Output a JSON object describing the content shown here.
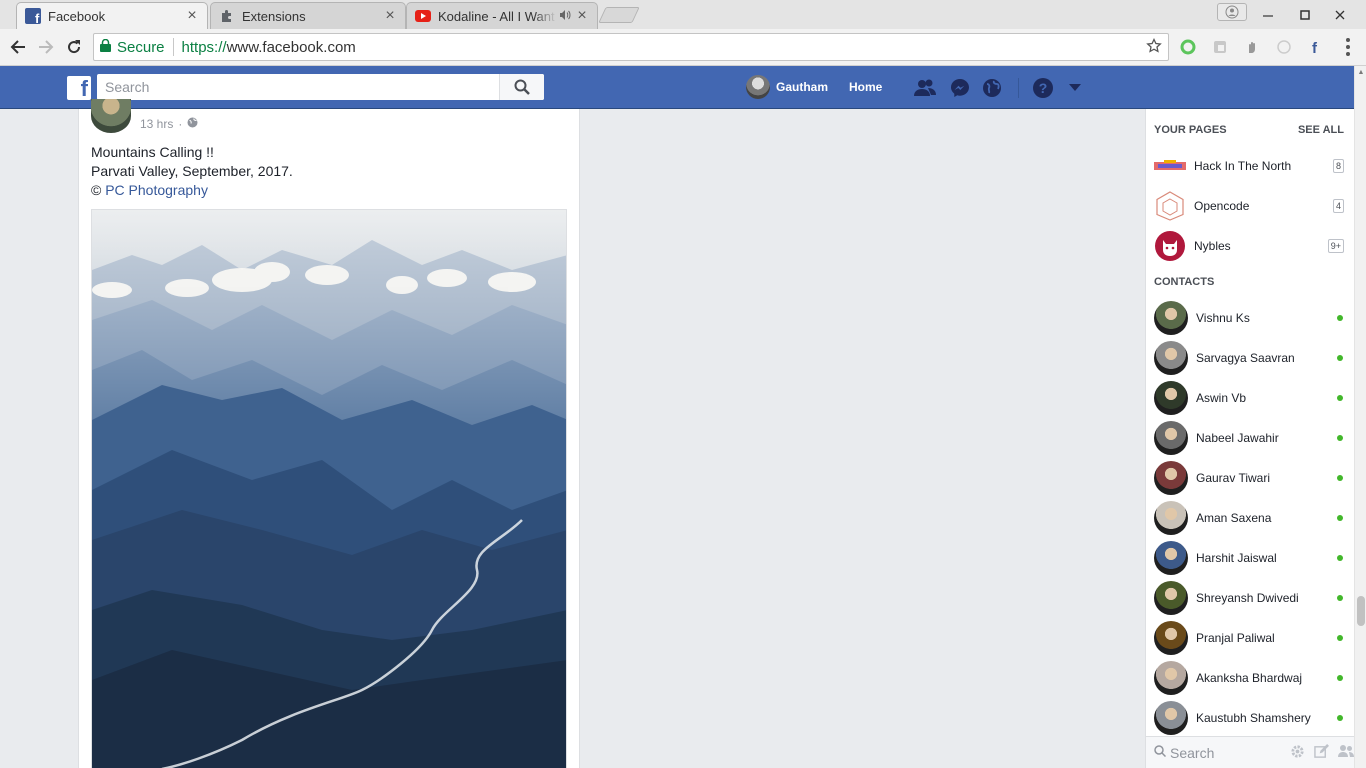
{
  "browser": {
    "tabs": [
      {
        "title": "Facebook",
        "icon": "facebook-favicon",
        "active": true
      },
      {
        "title": "Extensions",
        "icon": "puzzle-icon",
        "active": false
      },
      {
        "title": "Kodaline - All I Want",
        "icon": "youtube-favicon",
        "active": false,
        "audio": true
      }
    ],
    "secure_label": "Secure",
    "url_scheme": "https://",
    "url_host": "www.facebook.com"
  },
  "fb": {
    "search_placeholder": "Search",
    "user_name": "Gautham",
    "home_label": "Home",
    "brand_color": "#4267b2"
  },
  "post": {
    "time": "13 hrs",
    "dot": "·",
    "line1": "Mountains Calling !!",
    "line2": "Parvati Valley, September, 2017.",
    "copyright": "©",
    "credit_link": "PC Photography"
  },
  "sidebar": {
    "your_pages_label": "YOUR PAGES",
    "see_all_label": "SEE ALL",
    "pages": [
      {
        "name": "Hack In The North",
        "count": "8"
      },
      {
        "name": "Opencode",
        "count": "4"
      },
      {
        "name": "Nybles",
        "count": "9+"
      }
    ],
    "contacts_label": "CONTACTS",
    "contacts": [
      {
        "name": "Vishnu Ks",
        "color": "#5a6b4a"
      },
      {
        "name": "Sarvagya Saavran",
        "color": "#8a8a8a"
      },
      {
        "name": "Aswin Vb",
        "color": "#2f3a2a"
      },
      {
        "name": "Nabeel Jawahir",
        "color": "#6a6a6a"
      },
      {
        "name": "Gaurav Tiwari",
        "color": "#7a3a3a"
      },
      {
        "name": "Aman Saxena",
        "color": "#c9c2b8"
      },
      {
        "name": "Harshit Jaiswal",
        "color": "#3d5a8a"
      },
      {
        "name": "Shreyansh Dwivedi",
        "color": "#4a5a2a"
      },
      {
        "name": "Pranjal Paliwal",
        "color": "#6a4a1a"
      },
      {
        "name": "Akanksha Bhardwaj",
        "color": "#b5a8a0"
      },
      {
        "name": "Kaustubh Shamshery",
        "color": "#8a8f96"
      }
    ],
    "chat_search_placeholder": "Search",
    "online_color": "#42b72a"
  }
}
